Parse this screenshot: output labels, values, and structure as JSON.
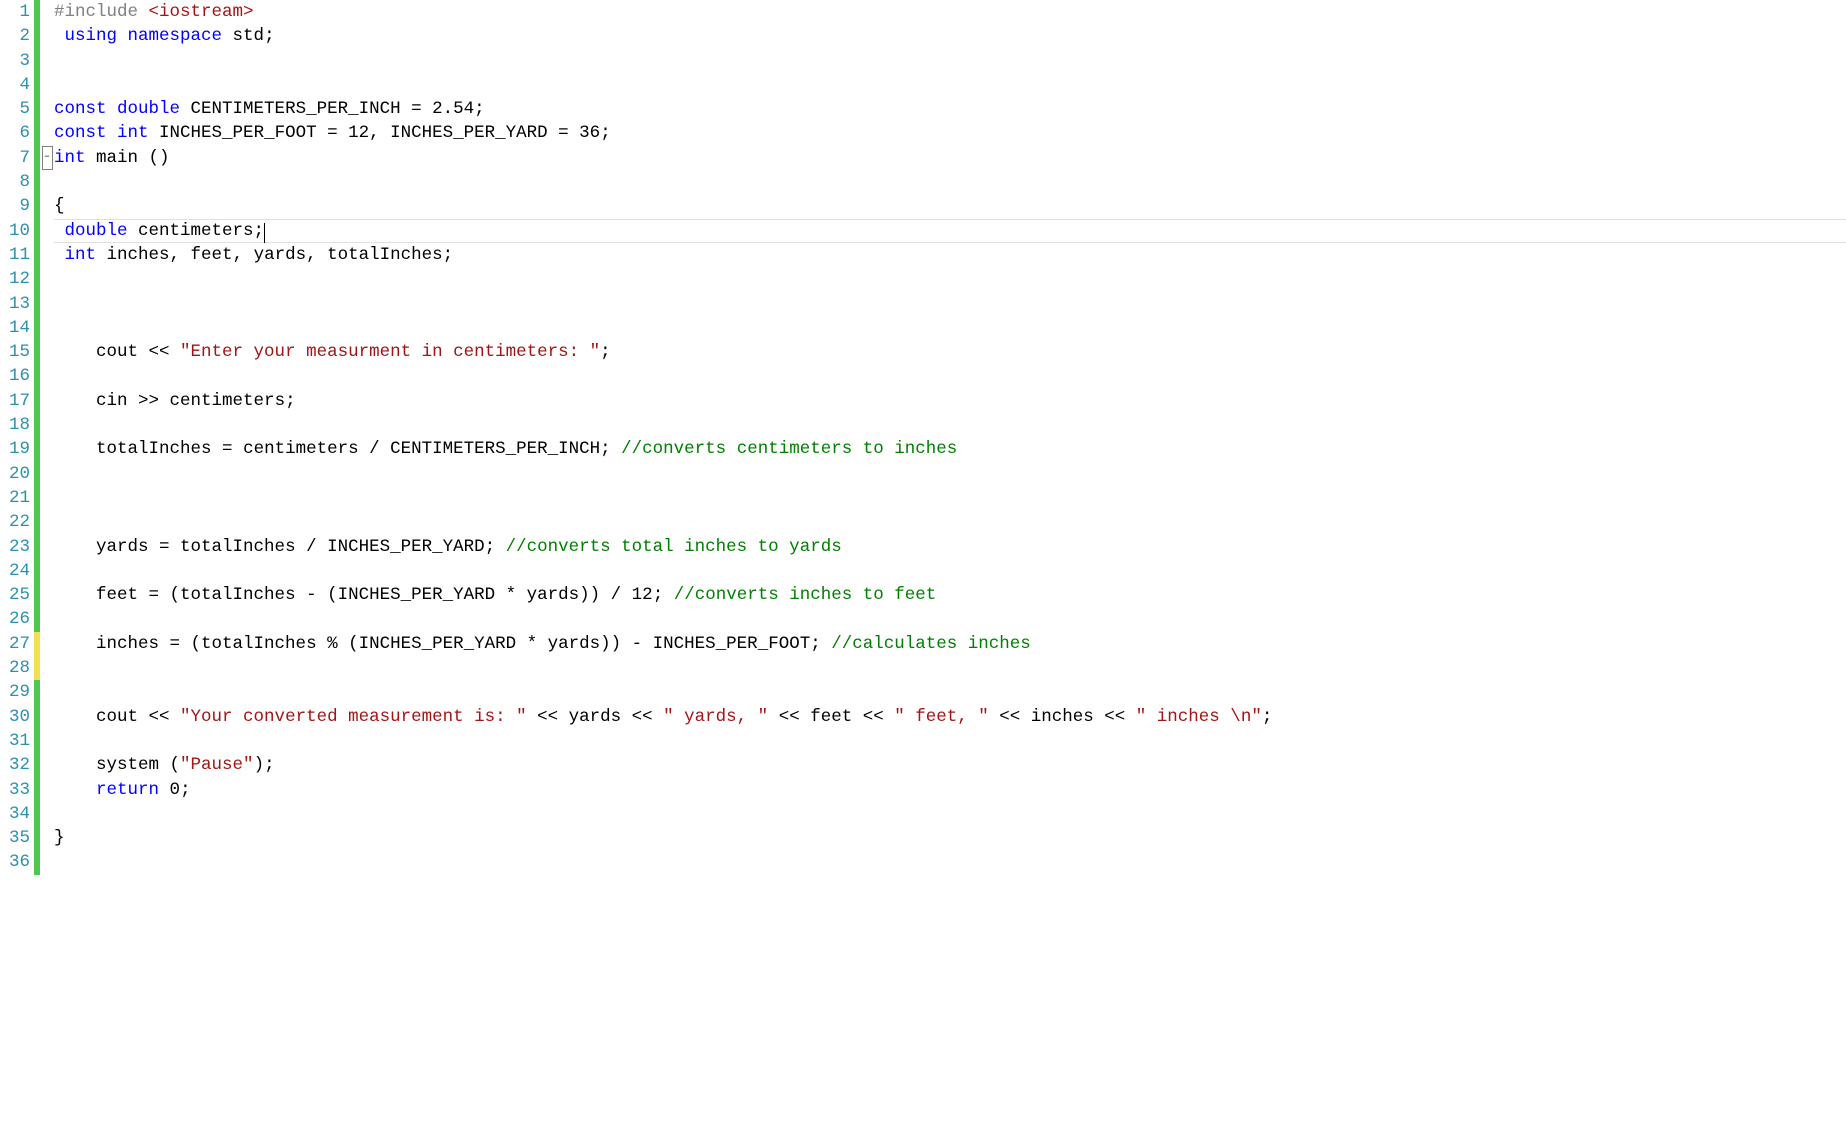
{
  "total_lines": 36,
  "current_line": 10,
  "lines": {
    "1": [
      [
        "tok-preproc",
        "#include "
      ],
      [
        "tok-string",
        "<iostream>"
      ]
    ],
    "2": [
      [
        "",
        ""
      ],
      [
        "tok-keyword",
        " using"
      ],
      [
        "tok-keyword",
        " namespace"
      ],
      [
        "tok-ident",
        " std"
      ],
      [
        "tok-op",
        ";"
      ]
    ],
    "3": [],
    "4": [],
    "5": [
      [
        "tok-keyword",
        "const"
      ],
      [
        "tok-op",
        " "
      ],
      [
        "tok-keyword",
        "double"
      ],
      [
        "tok-ident",
        " CENTIMETERS_PER_INCH"
      ],
      [
        "tok-op",
        " = "
      ],
      [
        "tok-number",
        "2.54"
      ],
      [
        "tok-op",
        ";"
      ]
    ],
    "6": [
      [
        "tok-keyword",
        "const"
      ],
      [
        "tok-op",
        " "
      ],
      [
        "tok-keyword",
        "int"
      ],
      [
        "tok-ident",
        " INCHES_PER_FOOT"
      ],
      [
        "tok-op",
        " = "
      ],
      [
        "tok-number",
        "12"
      ],
      [
        "tok-op",
        ", "
      ],
      [
        "tok-ident",
        "INCHES_PER_YARD"
      ],
      [
        "tok-op",
        " = "
      ],
      [
        "tok-number",
        "36"
      ],
      [
        "tok-op",
        ";"
      ]
    ],
    "7": [
      [
        "tok-keyword",
        "int"
      ],
      [
        "tok-ident",
        " main "
      ],
      [
        "tok-op",
        "()"
      ]
    ],
    "8": [],
    "9": [
      [
        "tok-op",
        "{"
      ]
    ],
    "10": [
      [
        "",
        ""
      ],
      [
        "tok-keyword",
        " double"
      ],
      [
        "tok-ident",
        " centimeters"
      ],
      [
        "tok-op",
        ";"
      ]
    ],
    "11": [
      [
        "",
        ""
      ],
      [
        "tok-keyword",
        " int"
      ],
      [
        "tok-ident",
        " inches"
      ],
      [
        "tok-op",
        ", "
      ],
      [
        "tok-ident",
        "feet"
      ],
      [
        "tok-op",
        ", "
      ],
      [
        "tok-ident",
        "yards"
      ],
      [
        "tok-op",
        ", "
      ],
      [
        "tok-ident",
        "totalInches"
      ],
      [
        "tok-op",
        ";"
      ]
    ],
    "12": [],
    "13": [],
    "14": [],
    "15": [
      [
        "",
        "    "
      ],
      [
        "tok-ident",
        "cout"
      ],
      [
        "tok-op",
        " << "
      ],
      [
        "tok-string",
        "\"Enter your measurment in centimeters: \""
      ],
      [
        "tok-op",
        ";"
      ]
    ],
    "16": [],
    "17": [
      [
        "",
        "    "
      ],
      [
        "tok-ident",
        "cin"
      ],
      [
        "tok-op",
        " >> "
      ],
      [
        "tok-ident",
        "centimeters"
      ],
      [
        "tok-op",
        ";"
      ]
    ],
    "18": [],
    "19": [
      [
        "",
        "    "
      ],
      [
        "tok-ident",
        "totalInches"
      ],
      [
        "tok-op",
        " = "
      ],
      [
        "tok-ident",
        "centimeters"
      ],
      [
        "tok-op",
        " / "
      ],
      [
        "tok-ident",
        "CENTIMETERS_PER_INCH"
      ],
      [
        "tok-op",
        "; "
      ],
      [
        "tok-comment",
        "//converts centimeters to inches"
      ]
    ],
    "20": [],
    "21": [],
    "22": [],
    "23": [
      [
        "",
        "    "
      ],
      [
        "tok-ident",
        "yards"
      ],
      [
        "tok-op",
        " = "
      ],
      [
        "tok-ident",
        "totalInches"
      ],
      [
        "tok-op",
        " / "
      ],
      [
        "tok-ident",
        "INCHES_PER_YARD"
      ],
      [
        "tok-op",
        "; "
      ],
      [
        "tok-comment",
        "//converts total inches to yards"
      ]
    ],
    "24": [],
    "25": [
      [
        "",
        "    "
      ],
      [
        "tok-ident",
        "feet"
      ],
      [
        "tok-op",
        " = ("
      ],
      [
        "tok-ident",
        "totalInches"
      ],
      [
        "tok-op",
        " - ("
      ],
      [
        "tok-ident",
        "INCHES_PER_YARD"
      ],
      [
        "tok-op",
        " * "
      ],
      [
        "tok-ident",
        "yards"
      ],
      [
        "tok-op",
        ")) / "
      ],
      [
        "tok-number",
        "12"
      ],
      [
        "tok-op",
        "; "
      ],
      [
        "tok-comment",
        "//converts inches to feet"
      ]
    ],
    "26": [],
    "27": [
      [
        "",
        "    "
      ],
      [
        "tok-ident",
        "inches"
      ],
      [
        "tok-op",
        " = ("
      ],
      [
        "tok-ident",
        "totalInches"
      ],
      [
        "tok-op",
        " % ("
      ],
      [
        "tok-ident",
        "INCHES_PER_YARD"
      ],
      [
        "tok-op",
        " * "
      ],
      [
        "tok-ident",
        "yards"
      ],
      [
        "tok-op",
        ")) - "
      ],
      [
        "tok-ident",
        "INCHES_PER_FOOT"
      ],
      [
        "tok-op",
        "; "
      ],
      [
        "tok-comment",
        "//calculates inches"
      ]
    ],
    "28": [],
    "29": [],
    "30": [
      [
        "",
        "    "
      ],
      [
        "tok-ident",
        "cout"
      ],
      [
        "tok-op",
        " << "
      ],
      [
        "tok-string",
        "\"Your converted measurement is: \""
      ],
      [
        "tok-op",
        " << "
      ],
      [
        "tok-ident",
        "yards"
      ],
      [
        "tok-op",
        " << "
      ],
      [
        "tok-string",
        "\" yards, \""
      ],
      [
        "tok-op",
        " << "
      ],
      [
        "tok-ident",
        "feet"
      ],
      [
        "tok-op",
        " << "
      ],
      [
        "tok-string",
        "\" feet, \""
      ],
      [
        "tok-op",
        " << "
      ],
      [
        "tok-ident",
        "inches"
      ],
      [
        "tok-op",
        " << "
      ],
      [
        "tok-string",
        "\" inches \\n\""
      ],
      [
        "tok-op",
        ";"
      ]
    ],
    "31": [],
    "32": [
      [
        "",
        "    "
      ],
      [
        "tok-ident",
        "system"
      ],
      [
        "tok-op",
        " ("
      ],
      [
        "tok-string",
        "\"Pause\""
      ],
      [
        "tok-op",
        ");"
      ]
    ],
    "33": [
      [
        "",
        "    "
      ],
      [
        "tok-keyword",
        "return"
      ],
      [
        "tok-op",
        " "
      ],
      [
        "tok-number",
        "0"
      ],
      [
        "tok-op",
        ";"
      ]
    ],
    "34": [],
    "35": [
      [
        "tok-op",
        "}"
      ]
    ]
  },
  "yellow_markers": [
    27,
    28
  ],
  "fold_line": 7,
  "fold_symbol": "−"
}
